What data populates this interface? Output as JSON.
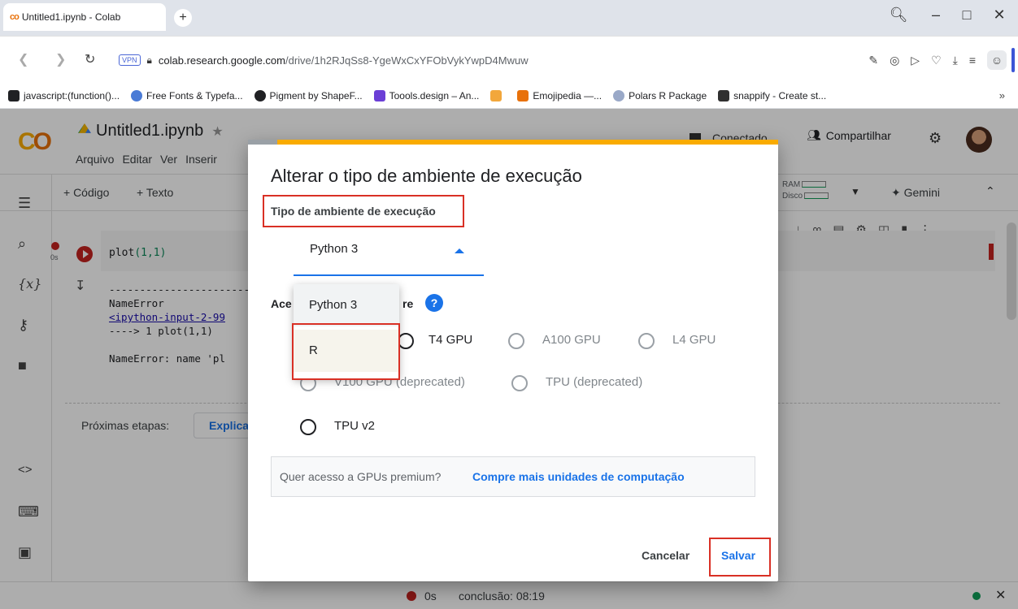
{
  "browser": {
    "tab_title": "Untitled1.ipynb - Colab",
    "tab_favicon": "co",
    "new_tab": "+",
    "url_host": "colab.research.google.com",
    "url_path": "/drive/1h2RJqSs8-YgeWxCxYFObVykYwpD4Mwuw",
    "vpn_badge": "VPN",
    "bookmarks": [
      {
        "label": "javascript:(function()...",
        "color": "#202124"
      },
      {
        "label": "Free Fonts & Typefa...",
        "color": "#4a7bd6"
      },
      {
        "label": "Pigment by ShapeF...",
        "color": "#202124"
      },
      {
        "label": "Toools.design – An...",
        "color": "#6b3fd6"
      },
      {
        "label": "",
        "color": "#f2a73b"
      },
      {
        "label": "Emojipedia —...",
        "color": "#e8710a"
      },
      {
        "label": "Polars R Package",
        "color": "#9aa9c8"
      },
      {
        "label": "snappify - Create st...",
        "color": "#303030"
      }
    ],
    "bookmarks_more": "»"
  },
  "colab": {
    "logo": "CO",
    "notebook_title": "Untitled1.ipynb",
    "menu": [
      "Arquivo",
      "Editar",
      "Ver",
      "Inserir"
    ],
    "connect_partial": "Conectado",
    "share": "Compartilhar",
    "toolbar": {
      "add_code": "+ Código",
      "add_text": "+ Texto",
      "ram": "RAM",
      "disk": "Disco",
      "gemini": "Gemini"
    },
    "cell": {
      "code_fn": "plot",
      "code_args": "(1,1)",
      "exec_time": "0s",
      "output_lines": [
        "---------------------------------",
        "NameError",
        "<ipython-input-2-99",
        "----> 1 plot(1,1)",
        "",
        "NameError: name 'pl"
      ]
    },
    "next_steps": "Próximas etapas:",
    "explain": "Explicar",
    "status": {
      "time": "0s",
      "done": "conclusão: 08:19"
    }
  },
  "dialog": {
    "title": "Alterar o tipo de ambiente de execução",
    "runtime_label": "Tipo de ambiente de execução",
    "runtime_value": "Python 3",
    "dropdown_options": [
      "Python 3",
      "R"
    ],
    "accel_label_start": "Ace",
    "accel_label_end": "re",
    "help": "?",
    "radios": [
      {
        "label": "T4 GPU",
        "disabled": false
      },
      {
        "label": "A100 GPU",
        "disabled": true
      },
      {
        "label": "L4 GPU",
        "disabled": true
      },
      {
        "label": "V100 GPU (deprecated)",
        "disabled": true
      },
      {
        "label": "TPU (deprecated)",
        "disabled": true
      },
      {
        "label": "TPU v2",
        "disabled": false
      }
    ],
    "promo_text": "Quer acesso a GPUs premium?",
    "promo_link": "Compre mais unidades de computação",
    "cancel": "Cancelar",
    "save": "Salvar"
  },
  "colors": {
    "highlight": "#d93025",
    "accent": "#1a73e8",
    "colab_orange": "#f9ab00"
  }
}
